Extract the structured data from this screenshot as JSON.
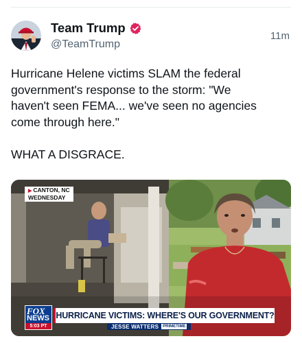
{
  "tweet": {
    "author": {
      "display_name": "Team Trump",
      "handle": "@TeamTrump",
      "verified": true,
      "verified_color": "#e0245e",
      "avatar_icon": "profile-avatar"
    },
    "timestamp": "11m",
    "text_lines": [
      "Hurricane Helene victims SLAM the federal",
      "government's response to the storm: \"We",
      "haven't seen FEMA... we've seen no agencies",
      "come through here.\""
    ],
    "text_emphasis": "WHAT A DISGRACE."
  },
  "media": {
    "type": "video-still",
    "location_badge": {
      "line1": "CANTON, NC",
      "line2": "WEDNESDAY"
    },
    "chyron": {
      "network_top": "FOX",
      "network_bottom": "NEWS",
      "time": "5:03 PT",
      "headline": "HURRICANE VICTIMS: WHERE'S OUR GOVERNMENT?",
      "host": "JESSE WATTERS",
      "show": "PRIMETIME"
    },
    "colors": {
      "fox_blue": "#0a3d8f",
      "fox_red": "#c8102e",
      "headline_text": "#0b1f4a"
    }
  }
}
